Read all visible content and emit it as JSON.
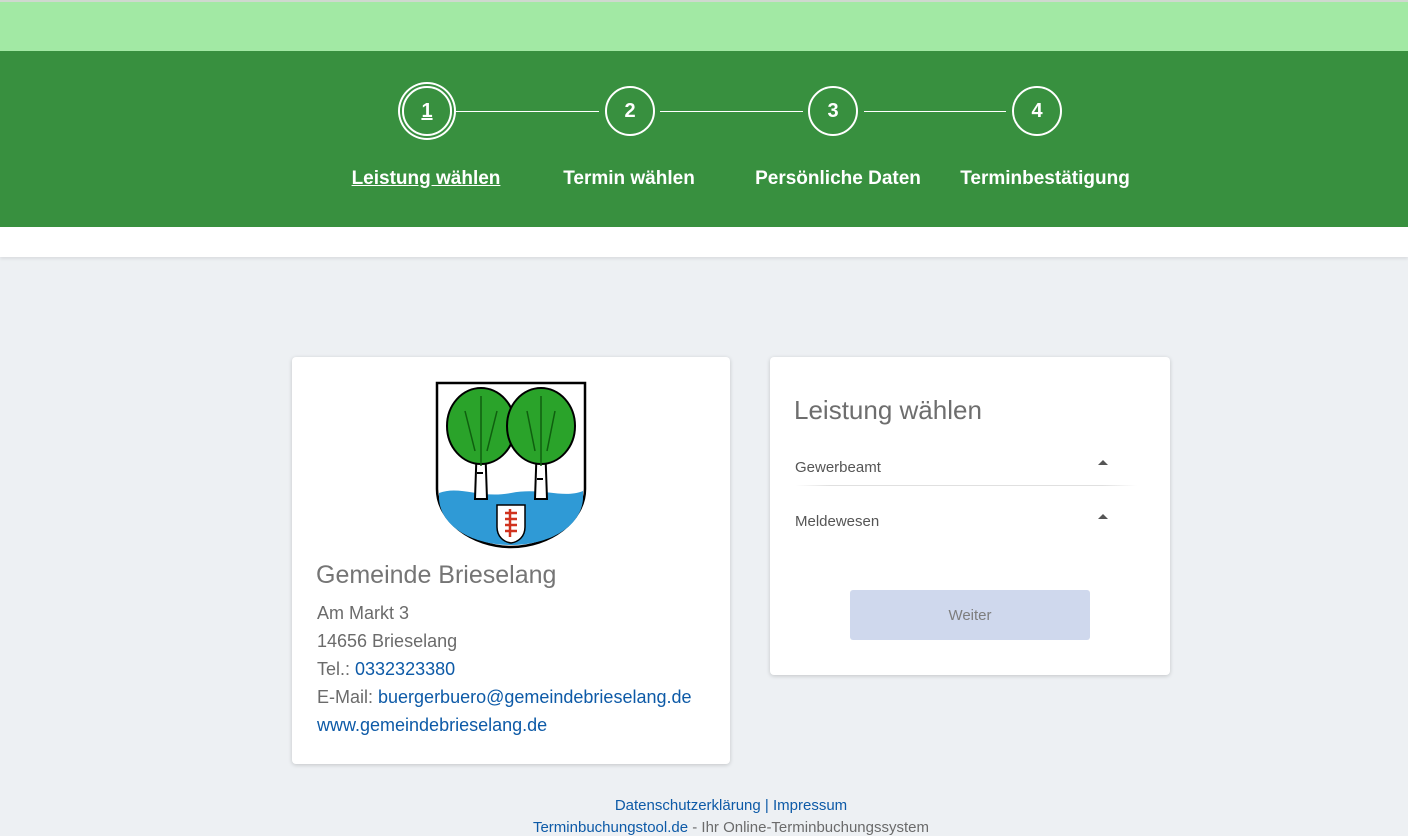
{
  "stepper": {
    "steps": [
      {
        "number": "1",
        "label": "Leistung wählen",
        "active": true
      },
      {
        "number": "2",
        "label": "Termin wählen",
        "active": false
      },
      {
        "number": "3",
        "label": "Persönliche Daten",
        "active": false
      },
      {
        "number": "4",
        "label": "Terminbestätigung",
        "active": false
      }
    ]
  },
  "contact": {
    "crest_icon": "coat-of-arms-brieselang",
    "name": "Gemeinde Brieselang",
    "street": "Am Markt 3",
    "city": "14656 Brieselang",
    "phone_label": "Tel.: ",
    "phone": "0332323380",
    "email_label": "E-Mail: ",
    "email": "buergerbuero@gemeindebrieselang.de",
    "website": "www.gemeindebrieselang.de"
  },
  "service": {
    "title": "Leistung wählen",
    "categories": [
      {
        "label": "Gewerbeamt",
        "icon": "caret-up-icon"
      },
      {
        "label": "Meldewesen",
        "icon": "caret-up-icon"
      }
    ],
    "next_button": "Weiter"
  },
  "footer": {
    "privacy": "Datenschutzerklärung",
    "separator": " | ",
    "imprint": "Impressum",
    "tool_link": "Terminbuchungstool.de",
    "tool_suffix": " - Ihr Online-Terminbuchungssystem"
  },
  "colors": {
    "top_bar": "#a2e9a4",
    "stepper_bg": "#38903f",
    "link": "#0d5aa7",
    "button_disabled": "#cfd8ed"
  }
}
